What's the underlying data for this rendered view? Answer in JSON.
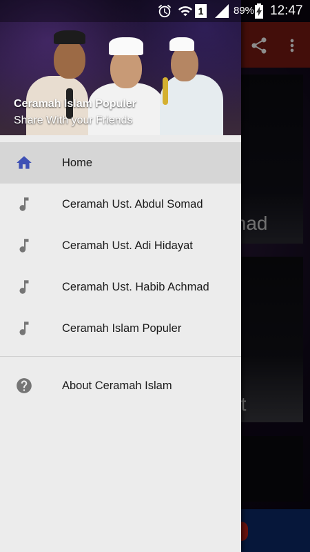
{
  "status_bar": {
    "battery_percent": "89%",
    "time": "12:47",
    "sim_badge": "1",
    "icons": [
      "alarm-icon",
      "wifi-icon",
      "signal-icon",
      "battery-charging-icon"
    ]
  },
  "background_app": {
    "toolbar_color": "#7a1b13",
    "toolbar_icons": [
      "share-icon",
      "more-vert-icon"
    ],
    "card_fragments": [
      "mad",
      "at"
    ]
  },
  "drawer": {
    "header": {
      "title": "Ceramah Islam Populer",
      "subtitle": "Share With your Friends"
    },
    "items": [
      {
        "label": "Home",
        "icon": "home-icon",
        "active": true
      },
      {
        "label": "Ceramah Ust. Abdul Somad",
        "icon": "music-note-icon",
        "active": false
      },
      {
        "label": "Ceramah Ust. Adi Hidayat",
        "icon": "music-note-icon",
        "active": false
      },
      {
        "label": "Ceramah Ust. Habib Achmad",
        "icon": "music-note-icon",
        "active": false
      },
      {
        "label": "Ceramah Islam Populer",
        "icon": "music-note-icon",
        "active": false
      }
    ],
    "secondary_items": [
      {
        "label": "About Ceramah Islam",
        "icon": "help-circle-icon"
      }
    ],
    "accent_color": "#3f51b5",
    "icon_color": "#757575"
  }
}
